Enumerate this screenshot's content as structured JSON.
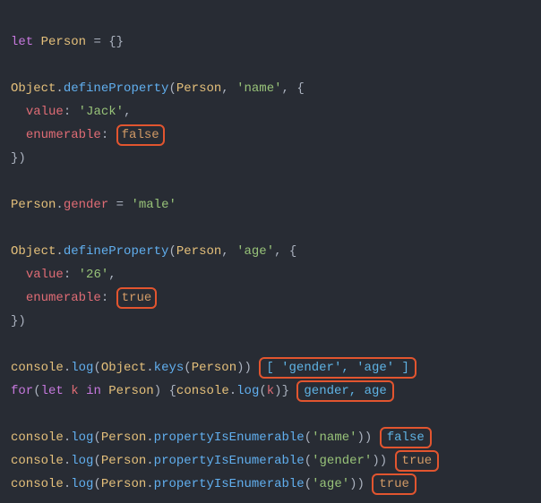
{
  "kw": {
    "let": "let",
    "for": "for",
    "in": "in"
  },
  "ident": {
    "Person": "Person",
    "Object": "Object",
    "console": "console",
    "k": "k"
  },
  "fn": {
    "defineProperty": "defineProperty",
    "log": "log",
    "keys": "keys",
    "propertyIsEnumerable": "propertyIsEnumerable"
  },
  "prop": {
    "value": "value",
    "enumerable": "enumerable",
    "gender": "gender"
  },
  "str": {
    "name": "'name'",
    "Jack": "'Jack'",
    "male": "'male'",
    "age": "'age'",
    "26": "'26'",
    "gender": "'gender'"
  },
  "bool": {
    "true": "true",
    "false": "false"
  },
  "out": {
    "keysResult": "[ 'gender', 'age' ]",
    "forResult": "gender, age",
    "enumName": "false",
    "enumGender": "true",
    "enumAge": "true"
  },
  "punc": {
    "eqEmpty": " = {}",
    "open": "(",
    "close": ")",
    "comma": ", ",
    "objOpen": "{",
    "objClose": "}",
    "colon": ": ",
    "dot": ".",
    "paren2": "))",
    "assign": " = ",
    "forOpen": "(",
    "forClose": ") {",
    "forEnd": "}",
    "indent2": "  ",
    "closeParen": ")"
  },
  "watermark": ""
}
